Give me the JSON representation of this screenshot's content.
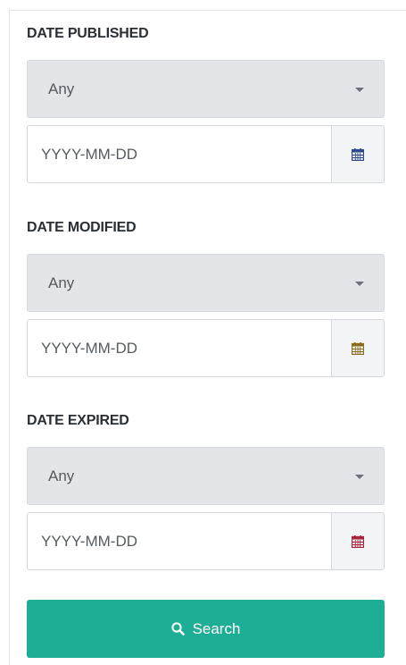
{
  "filters": [
    {
      "title": "DATE PUBLISHED",
      "select_value": "Any",
      "date_placeholder": "YYYY-MM-DD",
      "calendar_icon": "calendar-icon",
      "icon_color": "#2f4a8a"
    },
    {
      "title": "DATE MODIFIED",
      "select_value": "Any",
      "date_placeholder": "YYYY-MM-DD",
      "calendar_icon": "calendar-icon",
      "icon_color": "#8a6a1c"
    },
    {
      "title": "DATE EXPIRED",
      "select_value": "Any",
      "date_placeholder": "YYYY-MM-DD",
      "calendar_icon": "calendar-icon",
      "icon_color": "#a8243a"
    }
  ],
  "search_button": {
    "label": "Search",
    "icon": "search-icon",
    "color": "#1eae96"
  }
}
